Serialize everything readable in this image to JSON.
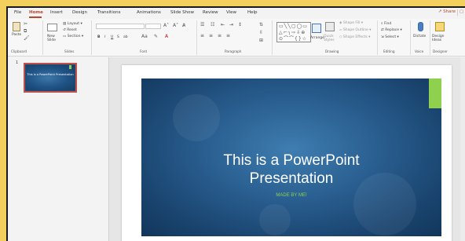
{
  "menu": {
    "tabs": [
      "File",
      "Home",
      "Insert",
      "Design",
      "Transitions",
      "Animations",
      "Slide Show",
      "Review",
      "View",
      "Help"
    ],
    "share": "Share"
  },
  "ribbon": {
    "clipboard": {
      "paste": "Paste",
      "label": "Clipboard"
    },
    "slides": {
      "new_slide": "New Slide",
      "layout": "Layout",
      "reset": "Reset",
      "section": "Section",
      "label": "Slides"
    },
    "font": {
      "label": "Font",
      "bold": "B",
      "italic": "I",
      "underline": "U",
      "strike": "S",
      "spacing": "ab"
    },
    "paragraph": {
      "label": "Paragraph"
    },
    "drawing": {
      "arrange": "Arrange",
      "quick_styles": "Quick Styles",
      "shape_fill": "Shape Fill",
      "shape_outline": "Shape Outline",
      "shape_effects": "Shape Effects",
      "label": "Drawing"
    },
    "editing": {
      "find": "Find",
      "replace": "Replace",
      "select": "Select",
      "label": "Editing"
    },
    "voice": {
      "dictate": "Dictate",
      "label": "Voice"
    },
    "designer": {
      "design_ideas": "Design Ideas",
      "label": "Designer"
    }
  },
  "thumbnails": [
    {
      "number": "1",
      "title": "This is a PowerPoint Presentation"
    }
  ],
  "slide": {
    "title_line1": "This is a PowerPoint",
    "title_line2": "Presentation",
    "subtitle": "MADE BY ME!",
    "accent_color": "#8fd14f",
    "bg_color": "#1f5284"
  }
}
